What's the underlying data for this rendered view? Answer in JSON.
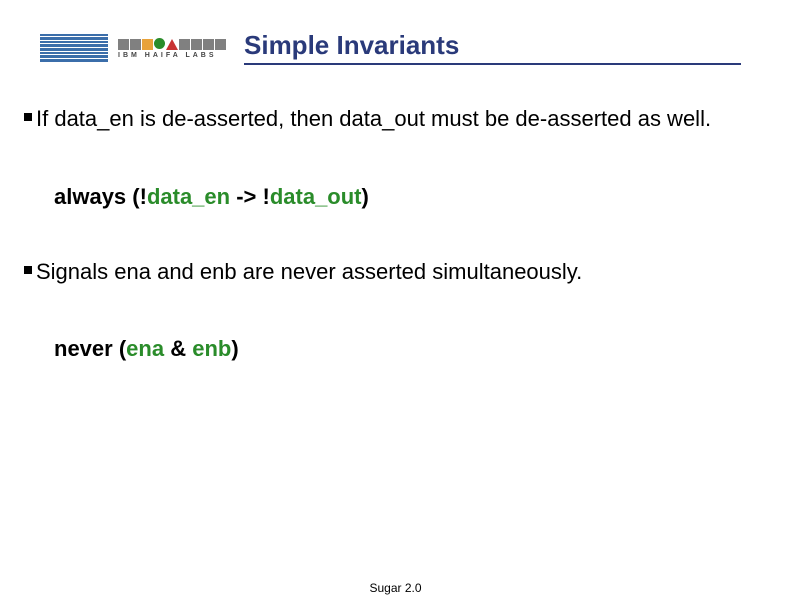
{
  "header": {
    "haifa_label": "IBM HAIFA LABS",
    "title": "Simple Invariants"
  },
  "body": {
    "bullet1": "If data_en is de-asserted, then data_out must be de-asserted as well.",
    "code1": {
      "kw": "always (",
      "neg1": "!",
      "sig1": "data_en",
      "arrow": " -> !",
      "sig2": "data_out",
      "close": ")"
    },
    "bullet2": "Signals ena and enb are never asserted simultaneously.",
    "code2": {
      "kw": "never (",
      "sig1": "ena",
      "amp": " & ",
      "sig2": "enb",
      "close": ")"
    }
  },
  "footer": "Sugar 2.0"
}
